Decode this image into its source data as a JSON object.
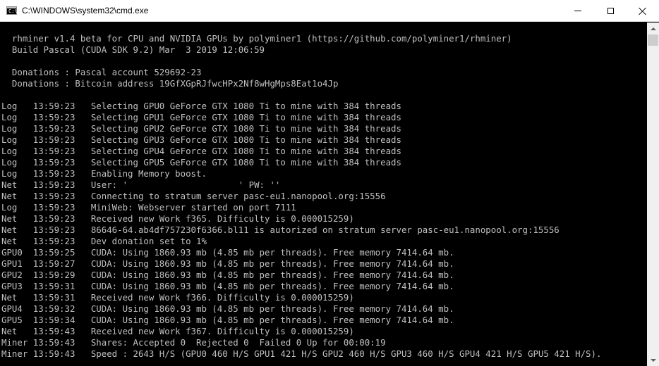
{
  "window": {
    "title": "C:\\WINDOWS\\system32\\cmd.exe",
    "icon": "cmd-icon",
    "icon_prompt": "C:\\",
    "controls": {
      "minimize": "minimize-icon",
      "maximize": "maximize-icon",
      "close": "close-icon"
    }
  },
  "colors": {
    "console_bg": "#000000",
    "console_fg": "#c0c0c0",
    "titlebar_bg": "#ffffff",
    "scrollbar_bg": "#f0f0f0"
  },
  "console": {
    "lines": [
      "  rhminer v1.4 beta for CPU and NVIDIA GPUs by polyminer1 (https://github.com/polyminer1/rhminer)",
      "  Build Pascal (CUDA SDK 9.2) Mar  3 2019 12:06:59",
      "",
      "  Donations : Pascal account 529692-23",
      "  Donations : Bitcoin address 19GfXGpRJfwcHPx2Nf8wHgMps8Eat1o4Jp",
      "",
      "Log   13:59:23   Selecting GPU0 GeForce GTX 1080 Ti to mine with 384 threads",
      "Log   13:59:23   Selecting GPU1 GeForce GTX 1080 Ti to mine with 384 threads",
      "Log   13:59:23   Selecting GPU2 GeForce GTX 1080 Ti to mine with 384 threads",
      "Log   13:59:23   Selecting GPU3 GeForce GTX 1080 Ti to mine with 384 threads",
      "Log   13:59:23   Selecting GPU4 GeForce GTX 1080 Ti to mine with 384 threads",
      "Log   13:59:23   Selecting GPU5 GeForce GTX 1080 Ti to mine with 384 threads",
      "Log   13:59:23   Enabling Memory boost.",
      "Net   13:59:23   User: '                     ' PW: ''",
      "Net   13:59:23   Connecting to stratum server pasc-eu1.nanopool.org:15556",
      "Log   13:59:23   MiniWeb: Webserver started on port 7111",
      "Net   13:59:23   Received new Work f365. Difficulty is 0.000015259)",
      "Net   13:59:23   86646-64.ab4df757230f6366.bl11 is autorized on stratum server pasc-eu1.nanopool.org:15556",
      "Net   13:59:23   Dev donation set to 1%",
      "GPU0  13:59:25   CUDA: Using 1860.93 mb (4.85 mb per threads). Free memory 7414.64 mb.",
      "GPU1  13:59:27   CUDA: Using 1860.93 mb (4.85 mb per threads). Free memory 7414.64 mb.",
      "GPU2  13:59:29   CUDA: Using 1860.93 mb (4.85 mb per threads). Free memory 7414.64 mb.",
      "GPU3  13:59:31   CUDA: Using 1860.93 mb (4.85 mb per threads). Free memory 7414.64 mb.",
      "Net   13:59:31   Received new Work f366. Difficulty is 0.000015259)",
      "GPU4  13:59:32   CUDA: Using 1860.93 mb (4.85 mb per threads). Free memory 7414.64 mb.",
      "GPU5  13:59:34   CUDA: Using 1860.93 mb (4.85 mb per threads). Free memory 7414.64 mb.",
      "Net   13:59:43   Received new Work f367. Difficulty is 0.000015259)",
      "Miner 13:59:43   Shares: Accepted 0  Rejected 0  Failed 0 Up for 00:00:19",
      "Miner 13:59:43   Speed : 2643 H/S (GPU0 460 H/S GPU1 421 H/S GPU2 460 H/S GPU3 460 H/S GPU4 421 H/S GPU5 421 H/S)."
    ]
  },
  "scrollbar": {
    "up": "scroll-up-arrow-icon",
    "down": "scroll-down-arrow-icon"
  }
}
